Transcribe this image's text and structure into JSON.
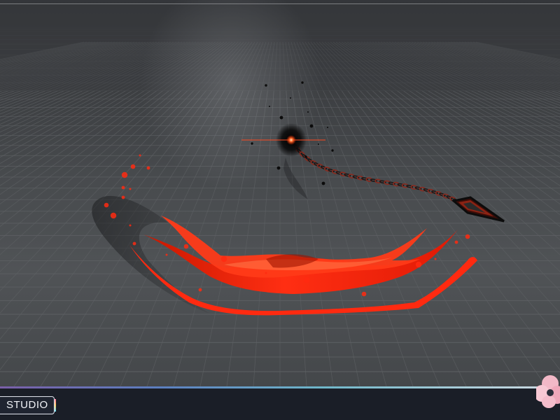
{
  "brand": {
    "label": "STUDIO",
    "logo_icon": "flower-logo-icon"
  },
  "colors": {
    "effect_red": "#ff2a10",
    "effect_dark_red": "#b81200",
    "effect_highlight": "#ff6a3a",
    "floor_grid": "#5e6164",
    "footer_background": "#1a1e27"
  },
  "scene": {
    "objects": [
      "slash-effect",
      "dark-orb",
      "chain",
      "arrowhead",
      "ember-particles",
      "floor-grid"
    ]
  }
}
